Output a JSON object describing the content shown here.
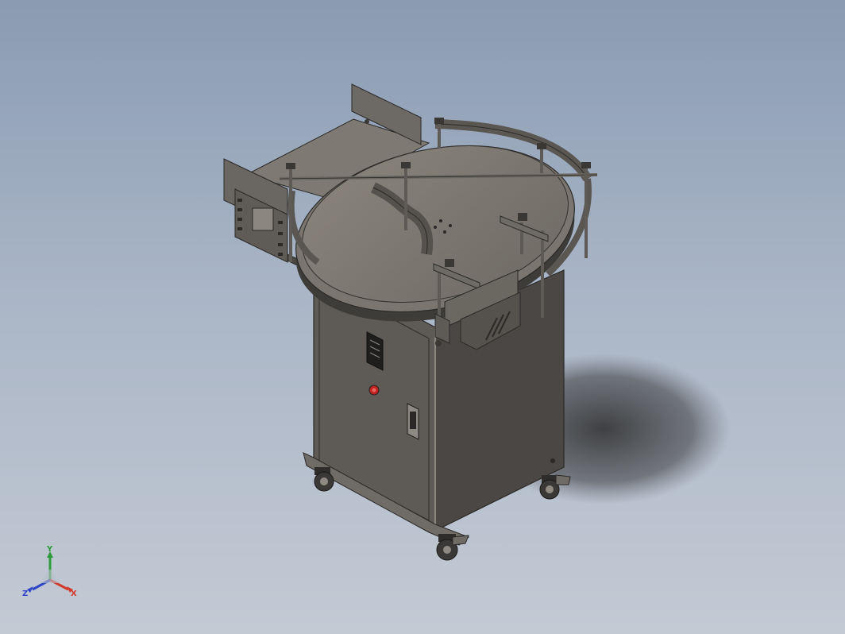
{
  "viewport": {
    "background_top": "#8a9bb2",
    "background_bottom": "#c3cad4"
  },
  "model": {
    "body_color": "#5e5b57",
    "body_dark": "#3c3a37",
    "body_light": "#77736e",
    "indicator_color": "#c0221f"
  },
  "triad": {
    "x_label": "X",
    "y_label": "Y",
    "z_label": "Z",
    "x_color": "#d33a2c",
    "y_color": "#2e9a3a",
    "z_color": "#2f45c8"
  }
}
